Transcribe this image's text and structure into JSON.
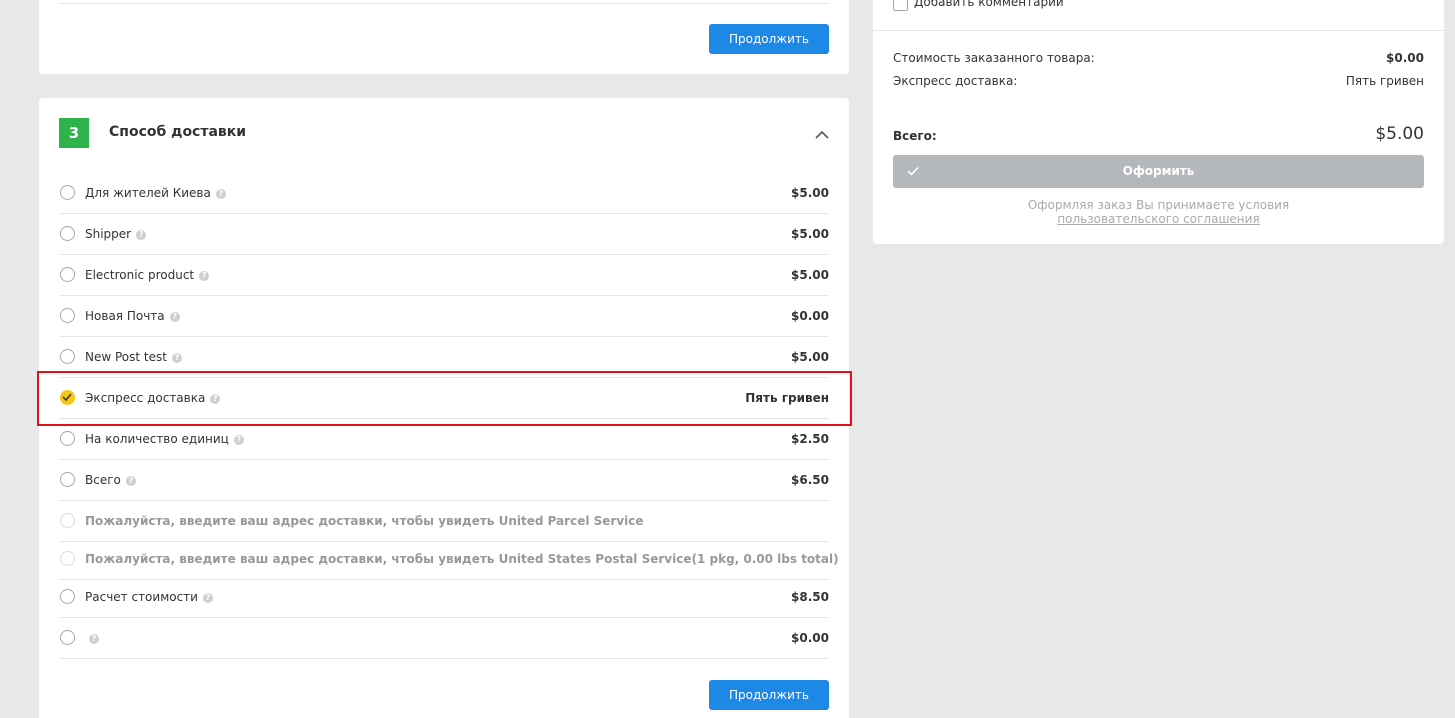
{
  "prev_section": {
    "continue_label": "Продолжить"
  },
  "shipping": {
    "step_number": "3",
    "title": "Способ доставки",
    "options": [
      {
        "label": "Для жителей Киева",
        "price": "$5.00",
        "selected": false,
        "disabled": false
      },
      {
        "label": "Shipper",
        "price": "$5.00",
        "selected": false,
        "disabled": false
      },
      {
        "label": "Electronic product",
        "price": "$5.00",
        "selected": false,
        "disabled": false
      },
      {
        "label": "Новая Почта",
        "price": "$0.00",
        "selected": false,
        "disabled": false
      },
      {
        "label": "New Post test",
        "price": "$5.00",
        "selected": false,
        "disabled": false
      },
      {
        "label": "Экспресс доставка",
        "price": "Пять гривен",
        "selected": true,
        "disabled": false
      },
      {
        "label": "На количество единиц",
        "price": "$2.50",
        "selected": false,
        "disabled": false
      },
      {
        "label": "Всего",
        "price": "$6.50",
        "selected": false,
        "disabled": false
      },
      {
        "label": "Пожалуйста, введите ваш адрес доставки, чтобы увидеть United Parcel Service",
        "price": "",
        "selected": false,
        "disabled": true
      },
      {
        "label": "Пожалуйста, введите ваш адрес доставки, чтобы увидеть United States Postal Service(1 pkg, 0.00 lbs total)",
        "price": "",
        "selected": false,
        "disabled": true
      },
      {
        "label": "Расчет стоимости",
        "price": "$8.50",
        "selected": false,
        "disabled": false
      },
      {
        "label": "",
        "price": "$0.00",
        "selected": false,
        "disabled": false
      }
    ],
    "continue_label": "Продолжить"
  },
  "summary": {
    "add_comment_label": "Добавить комментарий",
    "items_cost_label": "Стоимость заказанного товара:",
    "items_cost_value": "$0.00",
    "shipping_label": "Экспресс доставка:",
    "shipping_value": "Пять гривен",
    "total_label": "Всего:",
    "total_value": "$5.00",
    "order_button_label": "Оформить",
    "agreement_text": "Оформляя заказ Вы принимаете условия",
    "agreement_link": "пользовательского соглашения"
  },
  "colors": {
    "primary": "#1e88e5",
    "step_badge": "#2db34a",
    "selected_radio": "#f5c518",
    "highlight": "#e0131b",
    "order_button_disabled": "#b5b8ba"
  }
}
